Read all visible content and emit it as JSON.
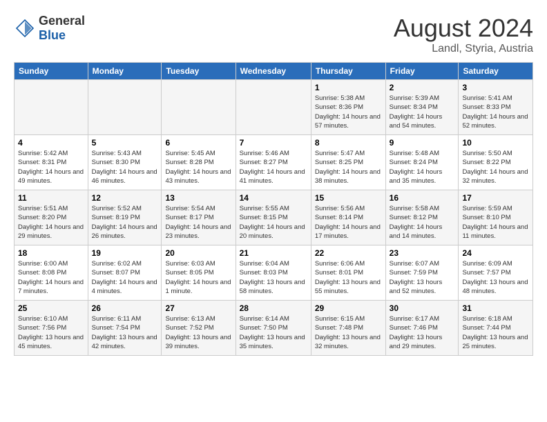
{
  "header": {
    "logo_general": "General",
    "logo_blue": "Blue",
    "month": "August 2024",
    "location": "Landl, Styria, Austria"
  },
  "days_of_week": [
    "Sunday",
    "Monday",
    "Tuesday",
    "Wednesday",
    "Thursday",
    "Friday",
    "Saturday"
  ],
  "weeks": [
    [
      {
        "day": "",
        "info": ""
      },
      {
        "day": "",
        "info": ""
      },
      {
        "day": "",
        "info": ""
      },
      {
        "day": "",
        "info": ""
      },
      {
        "day": "1",
        "info": "Sunrise: 5:38 AM\nSunset: 8:36 PM\nDaylight: 14 hours and 57 minutes."
      },
      {
        "day": "2",
        "info": "Sunrise: 5:39 AM\nSunset: 8:34 PM\nDaylight: 14 hours and 54 minutes."
      },
      {
        "day": "3",
        "info": "Sunrise: 5:41 AM\nSunset: 8:33 PM\nDaylight: 14 hours and 52 minutes."
      }
    ],
    [
      {
        "day": "4",
        "info": "Sunrise: 5:42 AM\nSunset: 8:31 PM\nDaylight: 14 hours and 49 minutes."
      },
      {
        "day": "5",
        "info": "Sunrise: 5:43 AM\nSunset: 8:30 PM\nDaylight: 14 hours and 46 minutes."
      },
      {
        "day": "6",
        "info": "Sunrise: 5:45 AM\nSunset: 8:28 PM\nDaylight: 14 hours and 43 minutes."
      },
      {
        "day": "7",
        "info": "Sunrise: 5:46 AM\nSunset: 8:27 PM\nDaylight: 14 hours and 41 minutes."
      },
      {
        "day": "8",
        "info": "Sunrise: 5:47 AM\nSunset: 8:25 PM\nDaylight: 14 hours and 38 minutes."
      },
      {
        "day": "9",
        "info": "Sunrise: 5:48 AM\nSunset: 8:24 PM\nDaylight: 14 hours and 35 minutes."
      },
      {
        "day": "10",
        "info": "Sunrise: 5:50 AM\nSunset: 8:22 PM\nDaylight: 14 hours and 32 minutes."
      }
    ],
    [
      {
        "day": "11",
        "info": "Sunrise: 5:51 AM\nSunset: 8:20 PM\nDaylight: 14 hours and 29 minutes."
      },
      {
        "day": "12",
        "info": "Sunrise: 5:52 AM\nSunset: 8:19 PM\nDaylight: 14 hours and 26 minutes."
      },
      {
        "day": "13",
        "info": "Sunrise: 5:54 AM\nSunset: 8:17 PM\nDaylight: 14 hours and 23 minutes."
      },
      {
        "day": "14",
        "info": "Sunrise: 5:55 AM\nSunset: 8:15 PM\nDaylight: 14 hours and 20 minutes."
      },
      {
        "day": "15",
        "info": "Sunrise: 5:56 AM\nSunset: 8:14 PM\nDaylight: 14 hours and 17 minutes."
      },
      {
        "day": "16",
        "info": "Sunrise: 5:58 AM\nSunset: 8:12 PM\nDaylight: 14 hours and 14 minutes."
      },
      {
        "day": "17",
        "info": "Sunrise: 5:59 AM\nSunset: 8:10 PM\nDaylight: 14 hours and 11 minutes."
      }
    ],
    [
      {
        "day": "18",
        "info": "Sunrise: 6:00 AM\nSunset: 8:08 PM\nDaylight: 14 hours and 7 minutes."
      },
      {
        "day": "19",
        "info": "Sunrise: 6:02 AM\nSunset: 8:07 PM\nDaylight: 14 hours and 4 minutes."
      },
      {
        "day": "20",
        "info": "Sunrise: 6:03 AM\nSunset: 8:05 PM\nDaylight: 14 hours and 1 minute."
      },
      {
        "day": "21",
        "info": "Sunrise: 6:04 AM\nSunset: 8:03 PM\nDaylight: 13 hours and 58 minutes."
      },
      {
        "day": "22",
        "info": "Sunrise: 6:06 AM\nSunset: 8:01 PM\nDaylight: 13 hours and 55 minutes."
      },
      {
        "day": "23",
        "info": "Sunrise: 6:07 AM\nSunset: 7:59 PM\nDaylight: 13 hours and 52 minutes."
      },
      {
        "day": "24",
        "info": "Sunrise: 6:09 AM\nSunset: 7:57 PM\nDaylight: 13 hours and 48 minutes."
      }
    ],
    [
      {
        "day": "25",
        "info": "Sunrise: 6:10 AM\nSunset: 7:56 PM\nDaylight: 13 hours and 45 minutes."
      },
      {
        "day": "26",
        "info": "Sunrise: 6:11 AM\nSunset: 7:54 PM\nDaylight: 13 hours and 42 minutes."
      },
      {
        "day": "27",
        "info": "Sunrise: 6:13 AM\nSunset: 7:52 PM\nDaylight: 13 hours and 39 minutes."
      },
      {
        "day": "28",
        "info": "Sunrise: 6:14 AM\nSunset: 7:50 PM\nDaylight: 13 hours and 35 minutes."
      },
      {
        "day": "29",
        "info": "Sunrise: 6:15 AM\nSunset: 7:48 PM\nDaylight: 13 hours and 32 minutes."
      },
      {
        "day": "30",
        "info": "Sunrise: 6:17 AM\nSunset: 7:46 PM\nDaylight: 13 hours and 29 minutes."
      },
      {
        "day": "31",
        "info": "Sunrise: 6:18 AM\nSunset: 7:44 PM\nDaylight: 13 hours and 25 minutes."
      }
    ]
  ]
}
